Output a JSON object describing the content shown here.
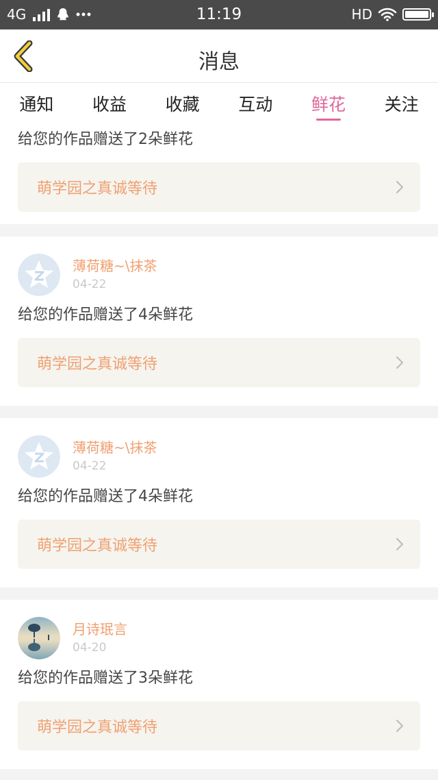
{
  "status_bar": {
    "network": "4G",
    "time": "11:19",
    "hd": "HD"
  },
  "header": {
    "title": "消息"
  },
  "tabs": [
    {
      "label": "通知",
      "active": false
    },
    {
      "label": "收益",
      "active": false
    },
    {
      "label": "收藏",
      "active": false
    },
    {
      "label": "互动",
      "active": false
    },
    {
      "label": "鲜花",
      "active": true
    },
    {
      "label": "关注",
      "active": false
    }
  ],
  "cards": [
    {
      "message": "给您的作品赠送了2朵鲜花",
      "work_title": "萌学园之真诚等待"
    },
    {
      "username": "薄荷糖~\\抹茶",
      "date": "04-22",
      "message": "给您的作品赠送了4朵鲜花",
      "work_title": "萌学园之真诚等待"
    },
    {
      "username": "薄荷糖~\\抹茶",
      "date": "04-22",
      "message": "给您的作品赠送了4朵鲜花",
      "work_title": "萌学园之真诚等待"
    },
    {
      "username": "月诗珉言",
      "date": "04-20",
      "message": "给您的作品赠送了3朵鲜花",
      "work_title": "萌学园之真诚等待"
    }
  ],
  "colors": {
    "accent": "#e0689a",
    "username": "#f0a070",
    "link_bg": "#f5f4ef"
  }
}
